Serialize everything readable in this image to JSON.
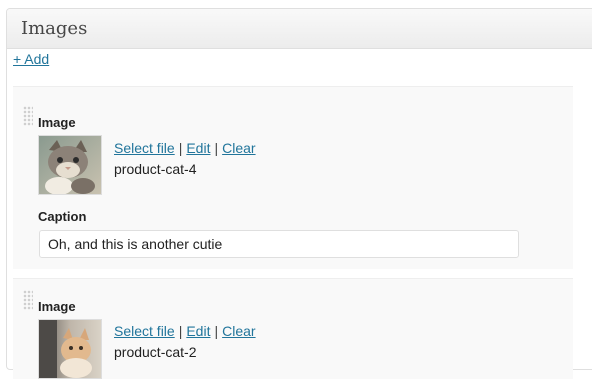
{
  "panel": {
    "title": "Images"
  },
  "add_link": "+ Add",
  "items": [
    {
      "field_label": "Image",
      "select_file": "Select file",
      "edit": "Edit",
      "clear": "Clear",
      "separator": "|",
      "filename": "product-cat-4",
      "caption_label": "Caption",
      "caption_value": "Oh, and this is another cutie"
    },
    {
      "field_label": "Image",
      "select_file": "Select file",
      "edit": "Edit",
      "clear": "Clear",
      "separator": "|",
      "filename": "product-cat-2"
    }
  ],
  "colors": {
    "link": "#21759b",
    "header_bg": "#ececec",
    "row_bg": "#f9f9f9"
  }
}
